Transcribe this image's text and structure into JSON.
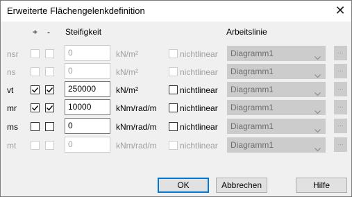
{
  "window": {
    "title": "Erweiterte Flächengelenkdefinition",
    "close_glyph": "✕"
  },
  "headers": {
    "plus": "+",
    "minus": "-",
    "stiffness": "Steifigkeit",
    "workline": "Arbeitslinie"
  },
  "rows": [
    {
      "name": "nsr",
      "plus_checked": false,
      "minus_checked": false,
      "value": "0",
      "unit": "kN/m²",
      "nonlinear_label": "nichtlinear",
      "nonlinear_checked": false,
      "diagram": "Diagramm1",
      "enabled": false
    },
    {
      "name": "ns",
      "plus_checked": false,
      "minus_checked": false,
      "value": "0",
      "unit": "kN/m²",
      "nonlinear_label": "nichtlinear",
      "nonlinear_checked": false,
      "diagram": "Diagramm1",
      "enabled": false
    },
    {
      "name": "vt",
      "plus_checked": true,
      "minus_checked": true,
      "value": "250000",
      "unit": "kN/m²",
      "nonlinear_label": "nichtlinear",
      "nonlinear_checked": false,
      "diagram": "Diagramm1",
      "enabled": true
    },
    {
      "name": "mr",
      "plus_checked": true,
      "minus_checked": true,
      "value": "10000",
      "unit": "kNm/rad/m",
      "nonlinear_label": "nichtlinear",
      "nonlinear_checked": false,
      "diagram": "Diagramm1",
      "enabled": true
    },
    {
      "name": "ms",
      "plus_checked": false,
      "minus_checked": false,
      "value": "0",
      "unit": "kNm/rad/m",
      "nonlinear_label": "nichtlinear",
      "nonlinear_checked": false,
      "diagram": "Diagramm1",
      "enabled": true
    },
    {
      "name": "mt",
      "plus_checked": false,
      "minus_checked": false,
      "value": "0",
      "unit": "kNm/rad/m",
      "nonlinear_label": "nichtlinear",
      "nonlinear_checked": false,
      "diagram": "Diagramm1",
      "enabled": false
    }
  ],
  "dots_label": "...",
  "buttons": {
    "ok": "OK",
    "cancel": "Abbrechen",
    "help": "Hilfe"
  },
  "colors": {
    "focus_border": "#0078d7",
    "disabled_text": "#a0a0a0",
    "disabled_fill": "#cccccc",
    "dialog_bg": "#f0f0f0"
  }
}
